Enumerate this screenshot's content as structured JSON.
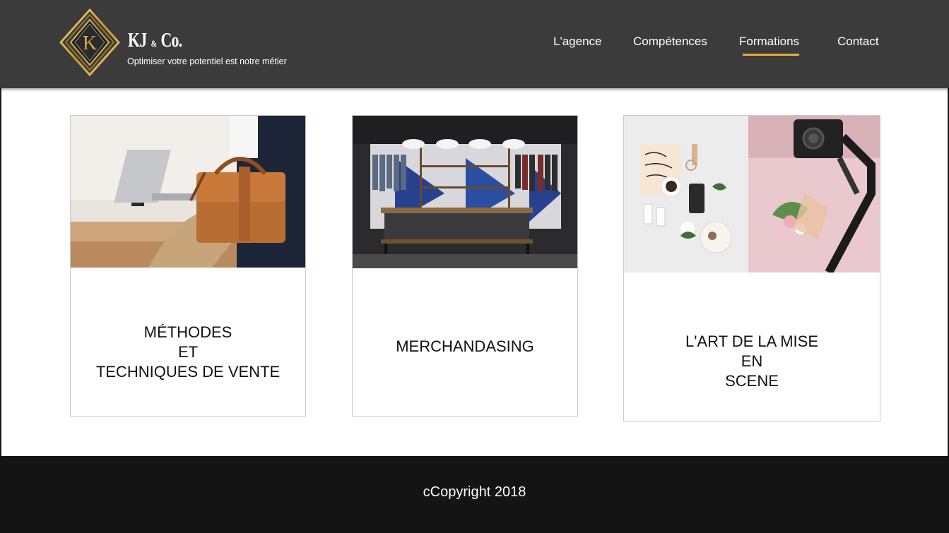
{
  "brand": {
    "name_main": "KJ",
    "name_amp": "&",
    "name_end": "Co.",
    "logo_letter": "K",
    "tagline": "Optimiser votre potentiel est notre métier"
  },
  "nav": {
    "items": [
      {
        "label": "L'agence",
        "active": false
      },
      {
        "label": "Compétences",
        "active": false
      },
      {
        "label": "Formations",
        "active": true
      },
      {
        "label": "Contact",
        "active": false
      }
    ],
    "accent_color": "#e2b132"
  },
  "cards": [
    {
      "title": "MÉTHODES\nET\nTECHNIQUES DE VENTE",
      "image": "man-laptop-leather-bag-photo"
    },
    {
      "title": "MERCHANDASING",
      "image": "clothing-store-interior-photo"
    },
    {
      "title": "L'ART DE LA MISE\nEN\nSCENE",
      "image": "flatlay-and-camera-photo"
    }
  ],
  "footer": {
    "copyright": "cCopyright 2018"
  },
  "colors": {
    "header_bg": "#3b3b3b",
    "footer_bg": "#141414",
    "gold": "#e2b132"
  }
}
